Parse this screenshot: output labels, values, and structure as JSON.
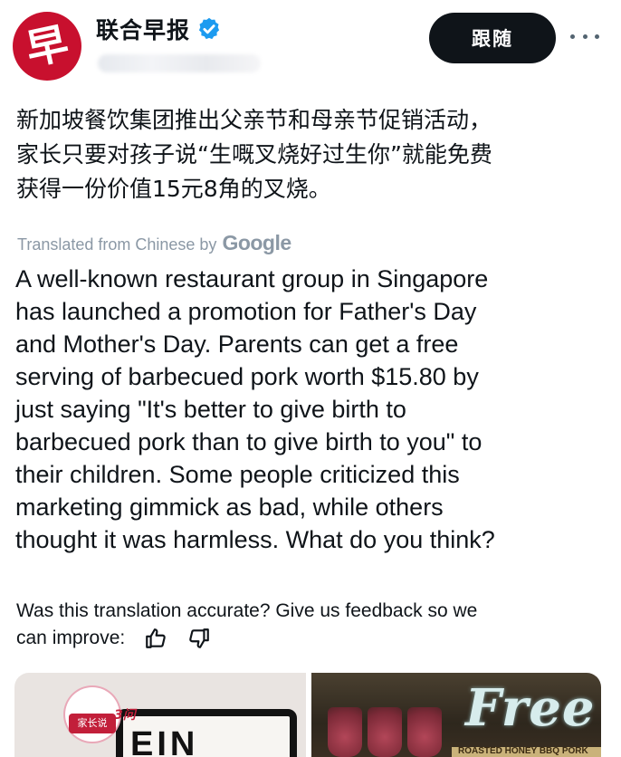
{
  "account": {
    "name": "联合早报",
    "avatar_text": "早",
    "verified_icon": "verified-badge-icon",
    "follow_label": "跟随",
    "more_icon": "more-options-icon"
  },
  "post": {
    "original_lines": [
      "新加坡餐饮集团推出父亲节和母亲节促销活动，",
      "家长只要对孩子说“生嘅叉烧好过生你”就能免费",
      "获得一份价值15元8角的叉烧。"
    ],
    "translated_by": "Translated from Chinese by",
    "translated_by_brand": "Google",
    "translation_lines": [
      "A well-known restaurant group in Singapore",
      "has launched a promotion for Father's Day",
      "and Mother's Day. Parents can get a free",
      "serving of barbecued pork worth $15.80 by",
      "just saying \"It's better to give birth to",
      "barbecued pork than to give birth to you\" to",
      "their children. Some people criticized this",
      "marketing gimmick as bad, while others",
      "thought it was harmless. What do you think?"
    ],
    "feedback_line1": "Was this translation accurate? Give us feedback so we",
    "feedback_line2": "can improve:",
    "thumbs_up_icon": "thumbs-up-icon",
    "thumbs_down_icon": "thumbs-down-icon"
  },
  "media": {
    "left_poster_text": "EIN",
    "left_cup_label": "家长说",
    "left_cup_number": "3问",
    "right_overlay_text": "Free",
    "right_banner_text": "ROASTED HONEY BBQ PORK"
  },
  "colors": {
    "brand_red": "#c8102e",
    "verified_blue": "#1d9bf0",
    "follow_bg": "#0f1419",
    "muted_text": "#8b98a5"
  }
}
